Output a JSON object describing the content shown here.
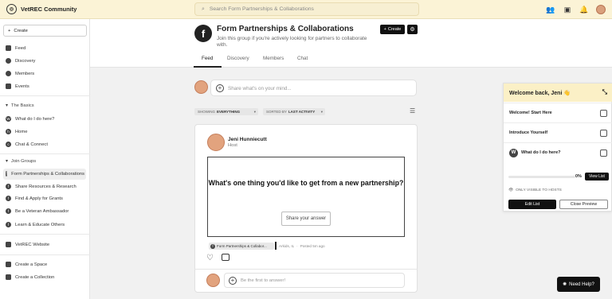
{
  "app": {
    "title": "VetREC Community"
  },
  "search": {
    "placeholder": "Search Form Partnerships & Collaborations"
  },
  "sidebar": {
    "create_label": "Create",
    "nav": [
      {
        "label": "Feed",
        "icon": "feed-icon"
      },
      {
        "label": "Discovery",
        "icon": "compass-icon"
      },
      {
        "label": "Members",
        "icon": "members-icon"
      },
      {
        "label": "Events",
        "icon": "calendar-icon"
      }
    ],
    "basics_title": "The Basics",
    "basics": [
      {
        "label": "What do I do here?",
        "icon": "w-icon"
      },
      {
        "label": "Home",
        "icon": "home-icon"
      },
      {
        "label": "Chat & Connect",
        "icon": "chat-icon"
      }
    ],
    "groups_title": "Join Groups",
    "groups": [
      {
        "label": "Form Partnerships & Collaborations",
        "icon": "f-icon"
      },
      {
        "label": "Share Resources & Research",
        "icon": "f-icon"
      },
      {
        "label": "Find & Apply for Grants",
        "icon": "f-icon"
      },
      {
        "label": "Be a Veteran Ambassador",
        "icon": "f-icon"
      },
      {
        "label": "Learn & Educate Others",
        "icon": "f-icon"
      }
    ],
    "website_label": "VetREC Website",
    "create_space_label": "Create a Space",
    "create_collection_label": "Create a Collection"
  },
  "group": {
    "title": "Form Partnerships & Collaborations",
    "description": "Join this group if you're actively looking for partners to collaborate with.",
    "create_label": "Create",
    "tabs": [
      "Feed",
      "Discovery",
      "Members",
      "Chat"
    ]
  },
  "composer": {
    "placeholder": "Share what's on your mind..."
  },
  "filters": {
    "showing_label": "SHOWING",
    "showing_value": "EVERYTHING",
    "sorted_label": "SORTED BY",
    "sorted_value": "LAST ACTIVITY"
  },
  "post": {
    "author": "Jeni Hunniecutt",
    "role": "Host",
    "question": "What's one thing you'd like to get from a new partnership?",
    "share_label": "Share your answer",
    "chip_label": "Form Partnerships & Collabor...",
    "location": "Arkids, IL",
    "posted": "Posted 5m ago",
    "reply_placeholder": "Be the first to answer!"
  },
  "checklist": {
    "welcome": "Welcome back, Jeni 👋",
    "items": [
      "Welcome! Start Here",
      "Introduce Yourself",
      "What do I do here?"
    ],
    "progress": "0%",
    "progress_value": 0,
    "view_list": "View List",
    "visibility": "ONLY VISIBLE TO HOSTS",
    "edit_list": "Edit List",
    "close_preview": "Close Preview"
  },
  "help": {
    "label": "Need Help?"
  }
}
